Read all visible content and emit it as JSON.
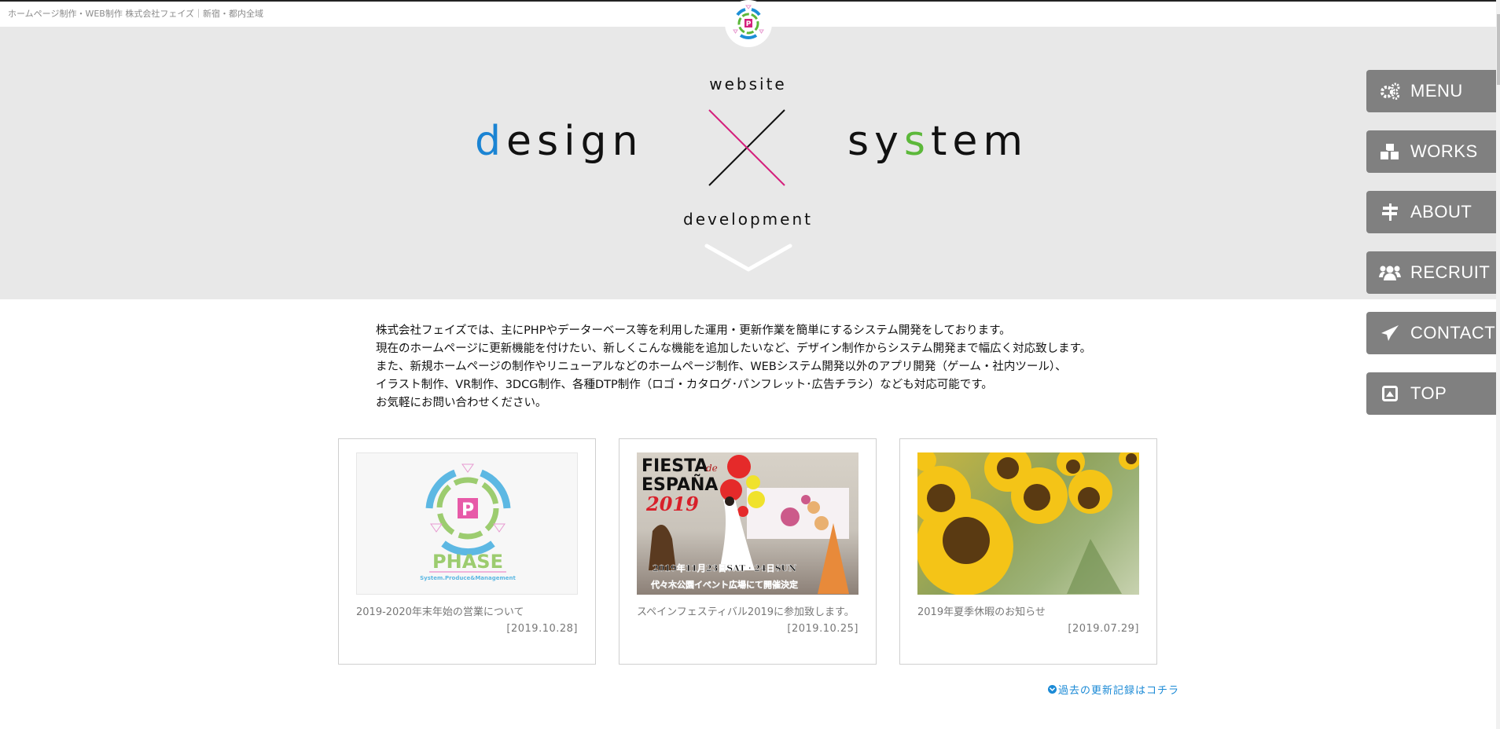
{
  "header": {
    "tagline": "ホームページ制作・WEB制作 株式会社フェイズ｜新宿・都内全域"
  },
  "hero": {
    "word_top": "website",
    "word_left_first": "d",
    "word_left_rest": "esign",
    "word_right_a": "sy",
    "word_right_b": "s",
    "word_right_c": "tem",
    "word_bottom": "development",
    "colors": {
      "accent_blue": "#1b84d3",
      "accent_green": "#5cb83a",
      "accent_pink": "#d4217d"
    }
  },
  "side_menu": [
    {
      "label": "MENU",
      "icon": "gears-icon"
    },
    {
      "label": "WORKS",
      "icon": "cubes-icon"
    },
    {
      "label": "ABOUT",
      "icon": "signpost-icon"
    },
    {
      "label": "RECRUIT",
      "icon": "users-icon"
    },
    {
      "label": "CONTACT",
      "icon": "paper-plane-icon"
    },
    {
      "label": "TOP",
      "icon": "caret-up-square-icon"
    }
  ],
  "intro": {
    "lines": [
      "株式会社フェイズでは、主にPHPやデーターベース等を利用した運用・更新作業を簡単にするシステム開発をしております。",
      "現在のホームページに更新機能を付けたい、新しくこんな機能を追加したいなど、デザイン制作からシステム開発まで幅広く対応致します。",
      "また、新規ホームページの制作やリニューアルなどのホームページ制作、WEBシステム開発以外のアプリ開発（ゲーム・社内ツール）、",
      "イラスト制作、VR制作、3DCG制作、各種DTP制作（ロゴ・カタログ･パンフレット･広告チラシ）なども対応可能です。",
      "お気軽にお問い合わせください。"
    ]
  },
  "news": [
    {
      "title": "2019-2020年末年始の営業について",
      "date": "[2019.10.28]",
      "image": "phase-logo-image",
      "logo_text": "PHASE",
      "logo_sub": "System.Produce&Management"
    },
    {
      "title": "スペインフェスティバル2019に参加致します。",
      "date": "[2019.10.25]",
      "image": "fiesta-de-espana-poster",
      "poster_title": "FIESTA de ESPAÑA",
      "poster_year": "2019",
      "poster_date": "2019年11月23日SAT・24日SUN",
      "poster_place": "代々木公園イベント広場にて開催決定"
    },
    {
      "title": "2019年夏季休暇のお知らせ",
      "date": "[2019.07.29]",
      "image": "sunflower-photo"
    }
  ],
  "more_link": {
    "label": "過去の更新記録はコチラ",
    "icon": "chevron-circle-down-icon"
  }
}
